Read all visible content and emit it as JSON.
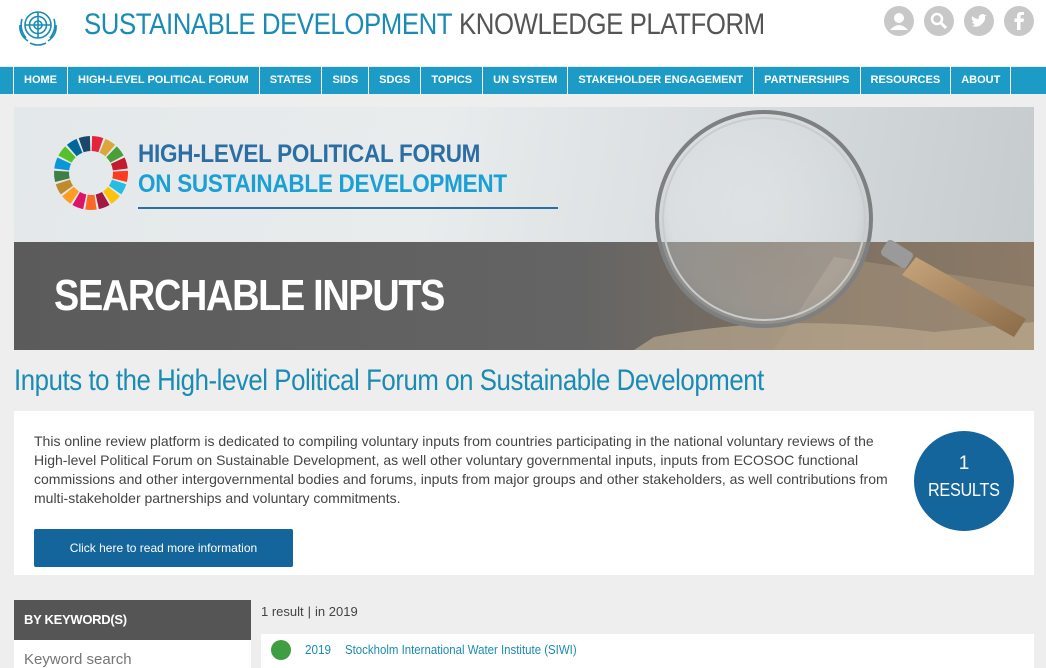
{
  "header": {
    "brand_part1": "SUSTAINABLE DEVELOPMENT",
    "brand_part2": "KNOWLEDGE PLATFORM",
    "icons": [
      "user-icon",
      "search-icon",
      "twitter-icon",
      "facebook-icon"
    ]
  },
  "nav": {
    "items": [
      {
        "label": "HOME"
      },
      {
        "label": "HIGH-LEVEL POLITICAL FORUM"
      },
      {
        "label": "STATES"
      },
      {
        "label": "SIDS"
      },
      {
        "label": "SDGS"
      },
      {
        "label": "TOPICS"
      },
      {
        "label": "UN SYSTEM"
      },
      {
        "label": "STAKEHOLDER ENGAGEMENT"
      },
      {
        "label": "PARTNERSHIPS"
      },
      {
        "label": "RESOURCES"
      },
      {
        "label": "ABOUT"
      }
    ]
  },
  "banner": {
    "logo_line1": "HIGH-LEVEL POLITICAL FORUM",
    "logo_line2": "ON SUSTAINABLE DEVELOPMENT",
    "title": "SEARCHABLE INPUTS"
  },
  "page": {
    "title": "Inputs to the High-level Political Forum on Sustainable Development"
  },
  "intro": {
    "text": "This online review platform is dedicated to compiling voluntary inputs from countries participating in the national voluntary reviews of the High-level Political Forum on Sustainable Development, as well other voluntary governmental inputs, inputs from ECOSOC functional commissions and other intergovernmental bodies and forums, inputs from major groups and other stakeholders, as well contributions from multi-stakeholder partnerships and voluntary commitments.",
    "read_more_label": "Click here to read more information",
    "results_count": "1",
    "results_label": "RESULTS"
  },
  "sidebar": {
    "keyword_heading": "BY KEYWORD(S)",
    "keyword_placeholder": "Keyword search"
  },
  "results": {
    "count_text": "1 result",
    "separator": "|",
    "filter_text": "in 2019",
    "items": [
      {
        "year": "2019",
        "name": "Stockholm International Water Institute (SIWI)",
        "dot_color": "#3f9e41"
      }
    ]
  },
  "colors": {
    "brand_blue": "#1a8cb3",
    "nav_blue": "#1b9bc5",
    "dark_blue": "#14659c",
    "hlpf_blue": "#2b6ea3",
    "hlpf_light_blue": "#1ba0d6"
  }
}
